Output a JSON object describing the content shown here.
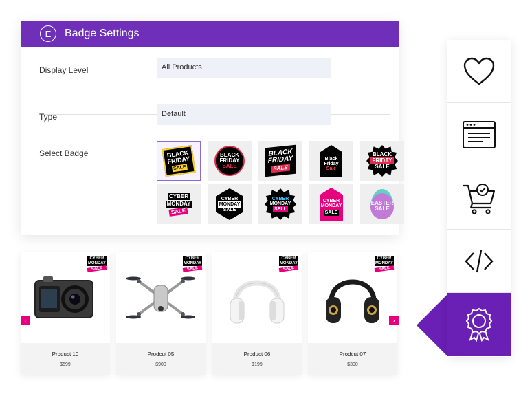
{
  "panel": {
    "logo_letter": "E",
    "title": "Badge Settings",
    "display_level": {
      "label": "Display Level",
      "value": "All Products"
    },
    "type": {
      "label": "Type",
      "value": "Default"
    },
    "select_badge": {
      "label": "Select Badge"
    }
  },
  "badges": [
    {
      "style": "b-rect",
      "l1": "BLACK",
      "l2": "FRIDAY",
      "l3": "SALE"
    },
    {
      "style": "b-circle",
      "l1": "BLACK",
      "l2": "FRIDAY",
      "l3": "SALE"
    },
    {
      "style": "b-slant",
      "l1": "BLACK",
      "l2": "FRIDAY",
      "l3": "SALE"
    },
    {
      "style": "b-tag",
      "l1": "Black",
      "l2": "Friday",
      "l3": "Sale"
    },
    {
      "style": "b-star",
      "l1": "BLACK",
      "l2": "FRIDAY",
      "l3": "SALE"
    },
    {
      "style": "b-cm1",
      "l1": "CYBER",
      "l2": "MONDAY",
      "l3": "SALE"
    },
    {
      "style": "b-hex",
      "l1": "CYBER",
      "l2": "MONDAY",
      "l3": "SALE"
    },
    {
      "style": "b-burst",
      "l1": "CYBER",
      "l2": "MONDAY",
      "l3": "SELL"
    },
    {
      "style": "b-tag2",
      "l1": "CYBER",
      "l2": "MONDAY",
      "l3": "SALE"
    },
    {
      "style": "b-egg",
      "l1": "EASTER",
      "l2": "SALE",
      "l3": ""
    }
  ],
  "selected_badge_index": 0,
  "product_badge": {
    "l1": "CYBER",
    "l2": "MONDAY",
    "l3": "SALE"
  },
  "products": [
    {
      "name": "Product 10",
      "price": "$599",
      "image": "action-camera"
    },
    {
      "name": "Prodcut 05",
      "price": "$900",
      "image": "drone"
    },
    {
      "name": "Product 06",
      "price": "$199",
      "image": "white-headphones"
    },
    {
      "name": "Prodcut 07",
      "price": "$300",
      "image": "black-headphones"
    }
  ],
  "carousel": {
    "prev": "‹",
    "next": "›"
  },
  "sidebar_icons": [
    {
      "name": "wishlist-heart-icon"
    },
    {
      "name": "browser-window-icon"
    },
    {
      "name": "cart-check-icon"
    },
    {
      "name": "code-icon"
    },
    {
      "name": "award-badge-icon",
      "active": true
    }
  ],
  "colors": {
    "primary": "#6f2fb8",
    "accent": "#e6007e"
  }
}
